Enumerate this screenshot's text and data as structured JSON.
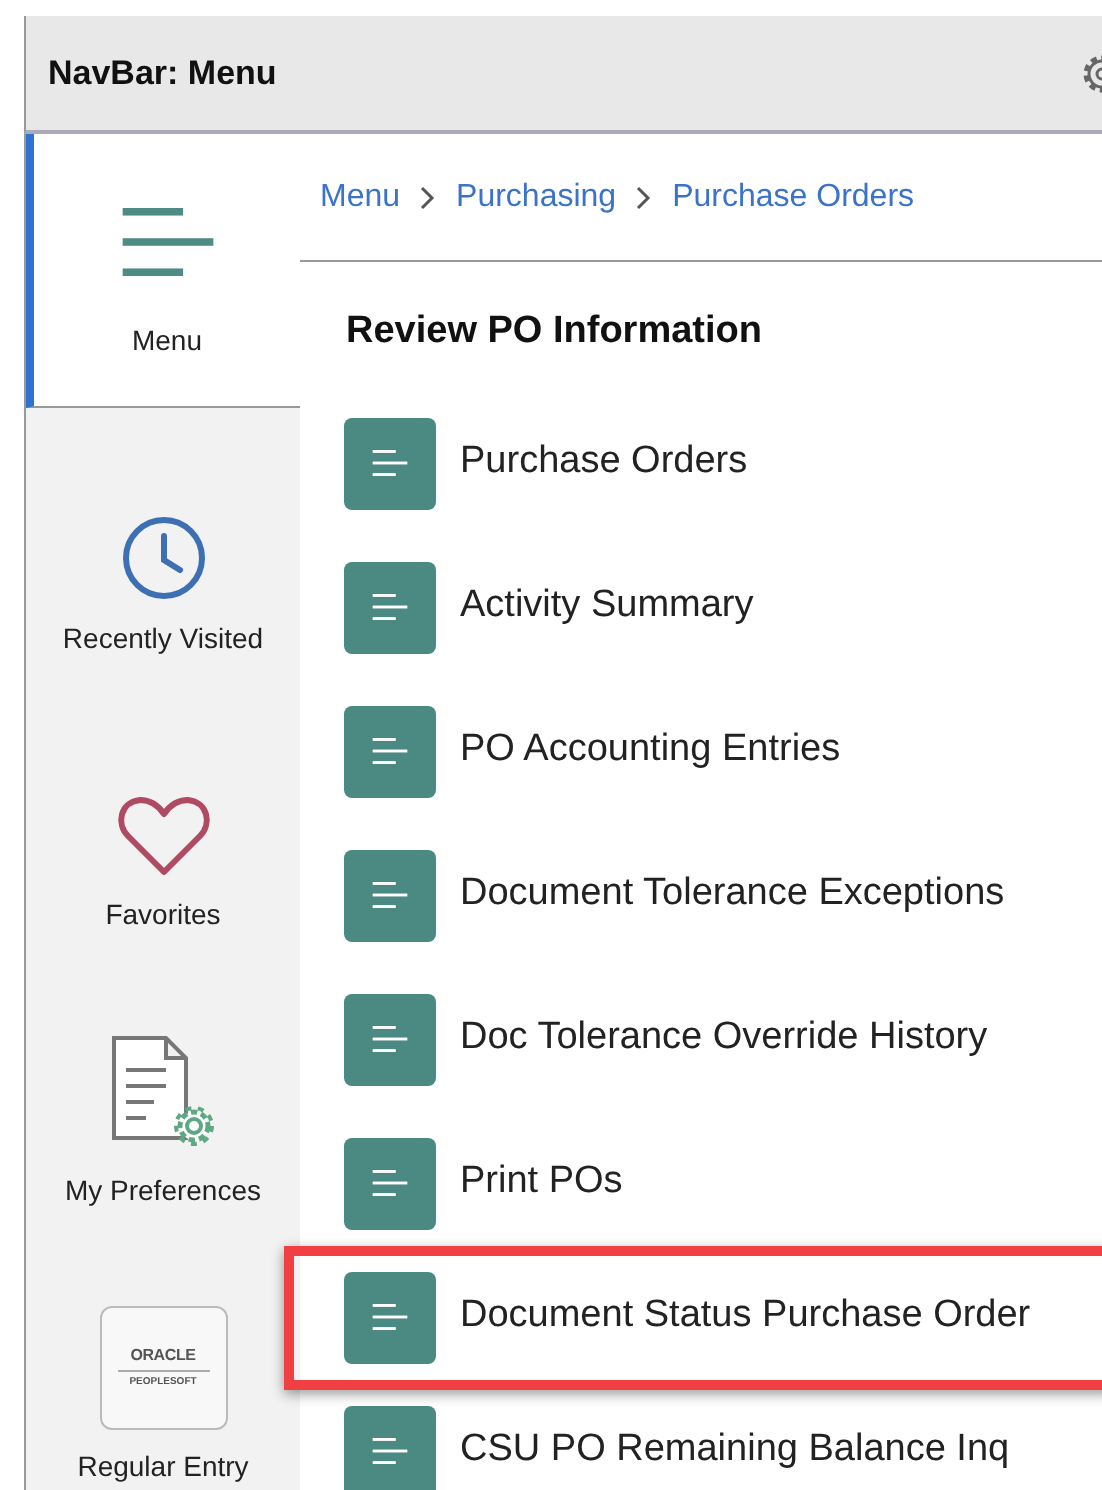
{
  "header": {
    "title": "NavBar: Menu"
  },
  "sidebar": {
    "items": [
      {
        "label": "Menu",
        "kind": "menu",
        "selected": true
      },
      {
        "label": "Recently Visited",
        "kind": "clock",
        "selected": false
      },
      {
        "label": "Favorites",
        "kind": "heart",
        "selected": false
      },
      {
        "label": "My Preferences",
        "kind": "preferences",
        "selected": false
      },
      {
        "label": "Regular Entry",
        "kind": "logo",
        "selected": false,
        "logo_lines": [
          "ORACLE",
          "PEOPLESOFT"
        ]
      }
    ]
  },
  "breadcrumb": [
    "Menu",
    "Purchasing",
    "Purchase Orders"
  ],
  "section_title": "Review PO Information",
  "items": [
    {
      "label": "Purchase Orders",
      "highlighted": false
    },
    {
      "label": "Activity Summary",
      "highlighted": false
    },
    {
      "label": "PO Accounting Entries",
      "highlighted": false
    },
    {
      "label": "Document Tolerance Exceptions",
      "highlighted": false
    },
    {
      "label": "Doc Tolerance Override History",
      "highlighted": false
    },
    {
      "label": "Print POs",
      "highlighted": false
    },
    {
      "label": "Document Status Purchase Order",
      "highlighted": true
    },
    {
      "label": "CSU PO Remaining Balance Inq",
      "highlighted": false
    }
  ]
}
